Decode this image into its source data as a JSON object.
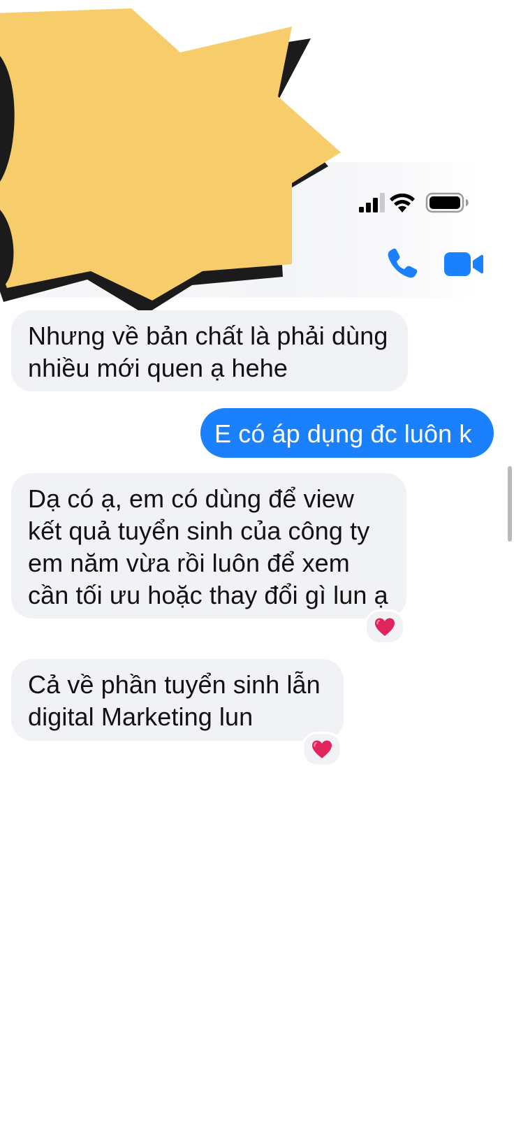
{
  "header": {
    "call_icon": "phone-icon",
    "video_icon": "video-camera-icon",
    "accent_color": "#1a80fb"
  },
  "status_bar": {
    "icons": [
      "cellular-signal-icon",
      "wifi-icon",
      "battery-icon"
    ]
  },
  "overlay": {
    "icon": "yellow-burst-sticker",
    "color": "#f6cd6a"
  },
  "messages": [
    {
      "direction": "incoming",
      "text": "Nhưng về bản chất là phải dùng\nnhiều mới quen ạ hehe",
      "reaction": ""
    },
    {
      "direction": "outgoing",
      "text": "E có áp dụng đc luôn k",
      "reaction": ""
    },
    {
      "direction": "incoming",
      "text": "Dạ có ạ, em có dùng để view\nkết quả tuyển sinh của công ty\nem năm vừa rồi luôn để xem\ncần tối ưu hoặc thay đổi gì lun ạ",
      "reaction": "heart-icon"
    },
    {
      "direction": "incoming",
      "text": "Cả về phần tuyển sinh lẫn\ndigital Marketing lun",
      "reaction": "heart-icon"
    }
  ],
  "colors": {
    "incoming_bubble": "#f1f2f6",
    "outgoing_bubble": "#1a80fb",
    "heart": "#e0245e"
  }
}
